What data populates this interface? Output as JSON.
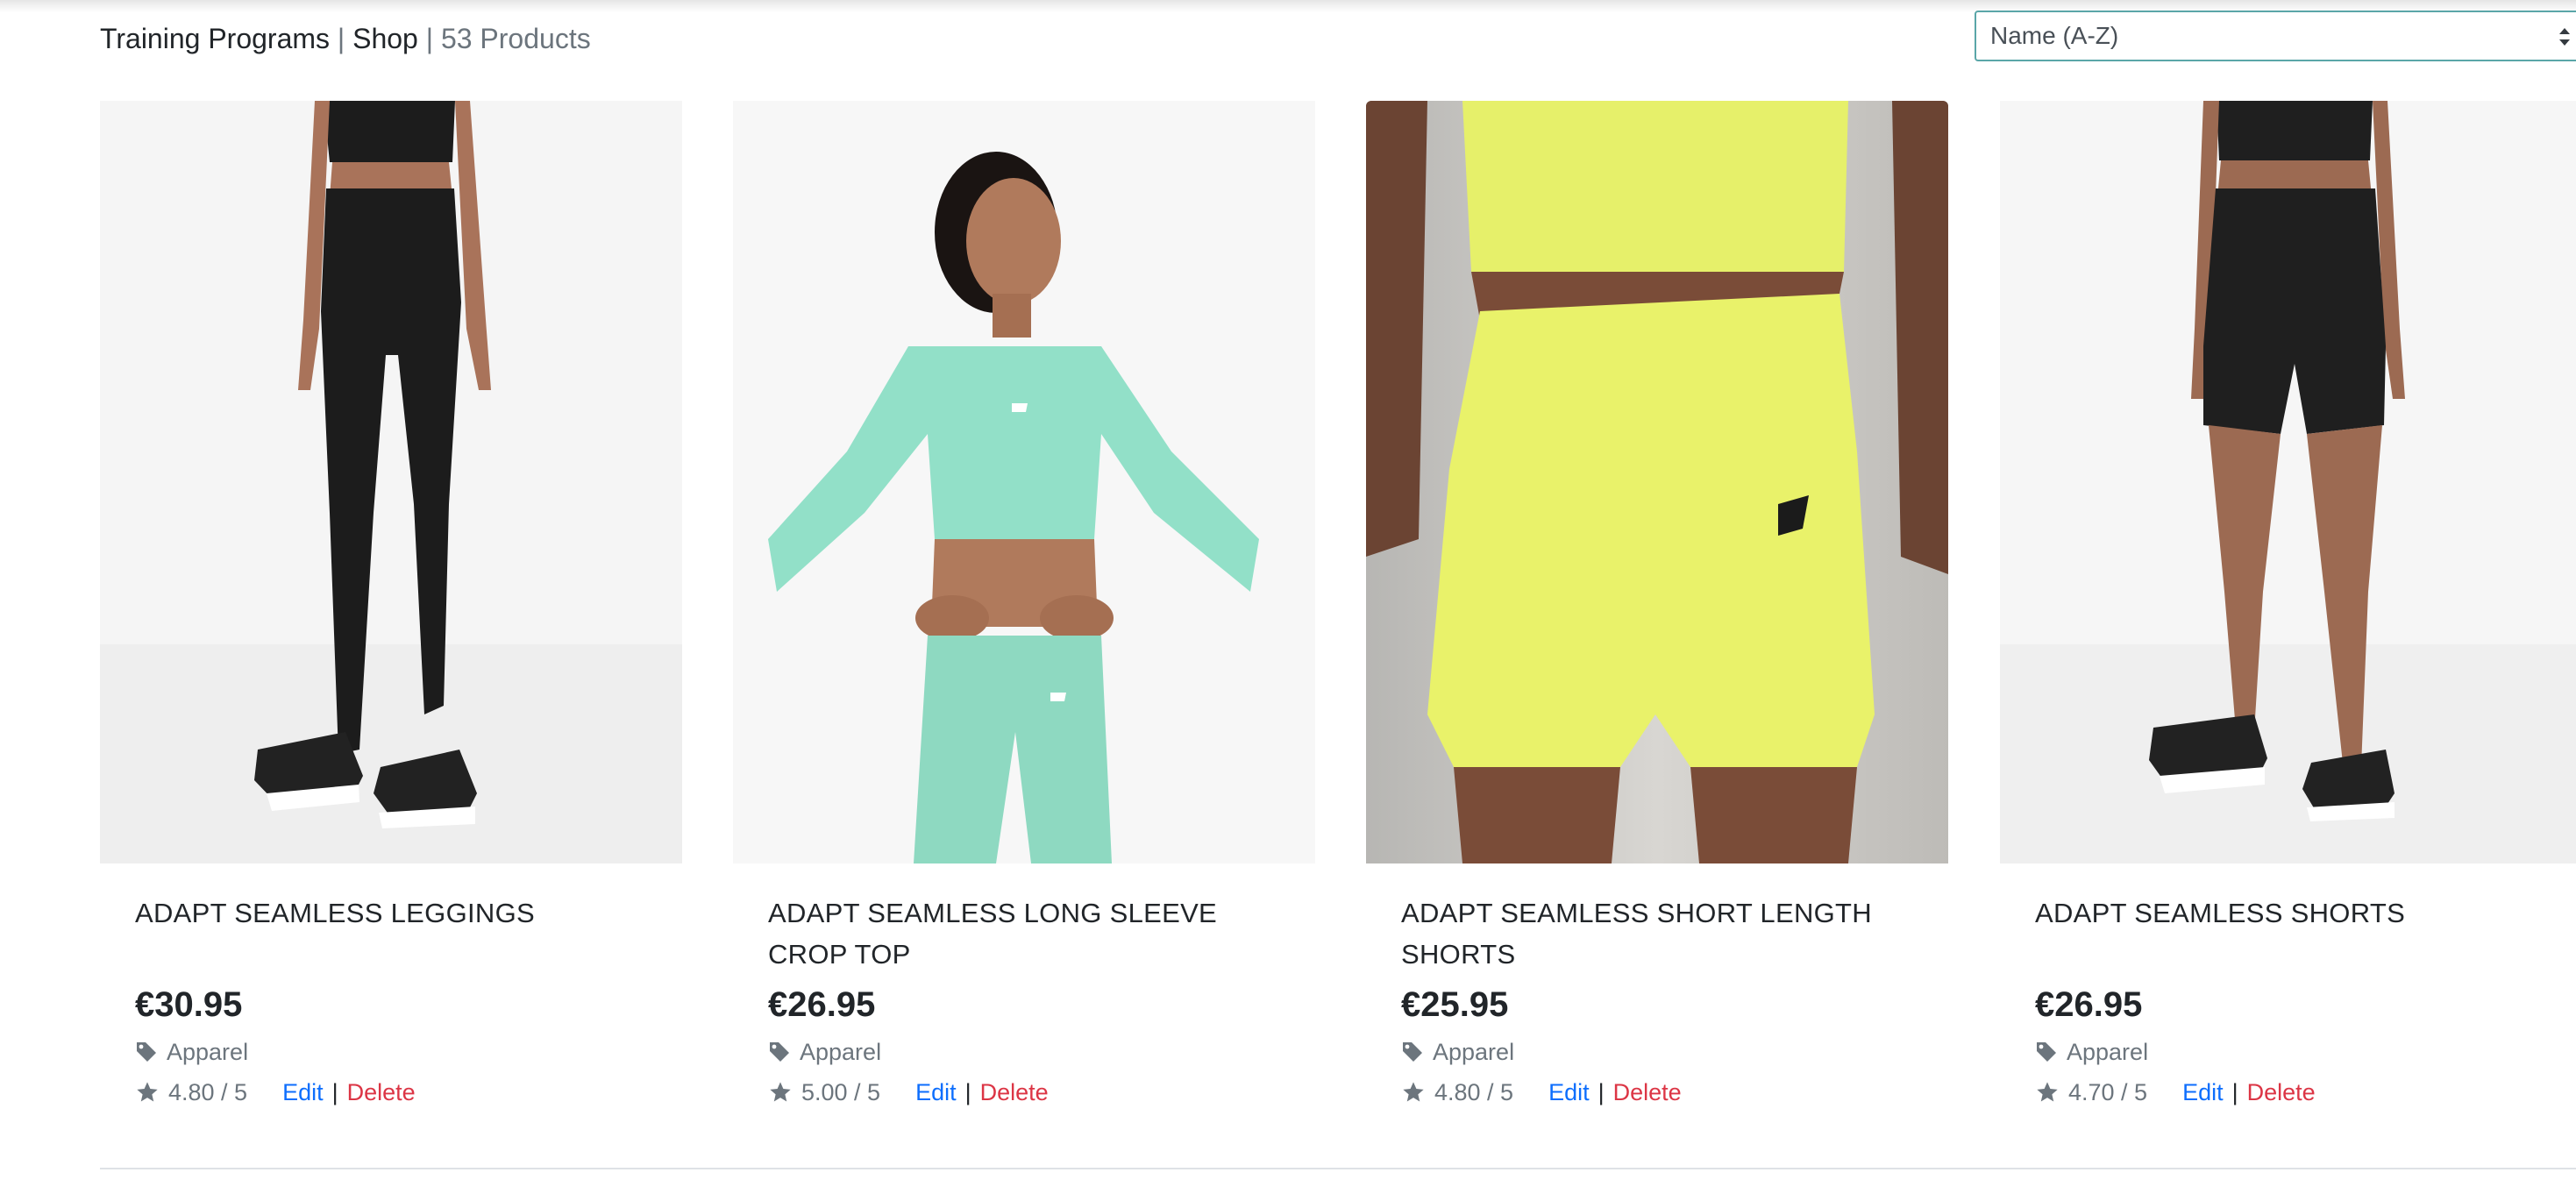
{
  "breadcrumb": {
    "training_programs": "Training Programs",
    "separator1": " | ",
    "shop": "Shop",
    "separator2": " | ",
    "product_count": "53 Products"
  },
  "sort": {
    "selected": "Name (A-Z)"
  },
  "products": [
    {
      "title": "ADAPT SEAMLESS LEGGINGS",
      "price": "€30.95",
      "category": "Apparel",
      "rating": "4.80 / 5",
      "edit_label": "Edit",
      "pipe": "|",
      "delete_label": "Delete",
      "image_background": "#f5f5f5",
      "garment_color": "#1c1c1c"
    },
    {
      "title": "ADAPT SEAMLESS LONG SLEEVE CROP TOP",
      "price": "€26.95",
      "category": "Apparel",
      "rating": "5.00 / 5",
      "edit_label": "Edit",
      "pipe": "|",
      "delete_label": "Delete",
      "image_background": "#f7f7f7",
      "garment_color": "#92e0c8"
    },
    {
      "title": "ADAPT SEAMLESS SHORT LENGTH SHORTS",
      "price": "€25.95",
      "category": "Apparel",
      "rating": "4.80 / 5",
      "edit_label": "Edit",
      "pipe": "|",
      "delete_label": "Delete",
      "image_background": "#c9c7c4",
      "garment_color": "#e9f26a"
    },
    {
      "title": "ADAPT SEAMLESS SHORTS",
      "price": "€26.95",
      "category": "Apparel",
      "rating": "4.70 / 5",
      "edit_label": "Edit",
      "pipe": "|",
      "delete_label": "Delete",
      "image_background": "#f6f6f6",
      "garment_color": "#1f1f1f"
    }
  ],
  "colors": {
    "link": "#0d6efd",
    "danger": "#dc3545",
    "muted": "#6c757d",
    "text": "#212529",
    "select_border": "#5aa6a8"
  },
  "icons": {
    "category": "tag-icon",
    "rating": "star-icon",
    "select": "sort-arrows-icon"
  }
}
